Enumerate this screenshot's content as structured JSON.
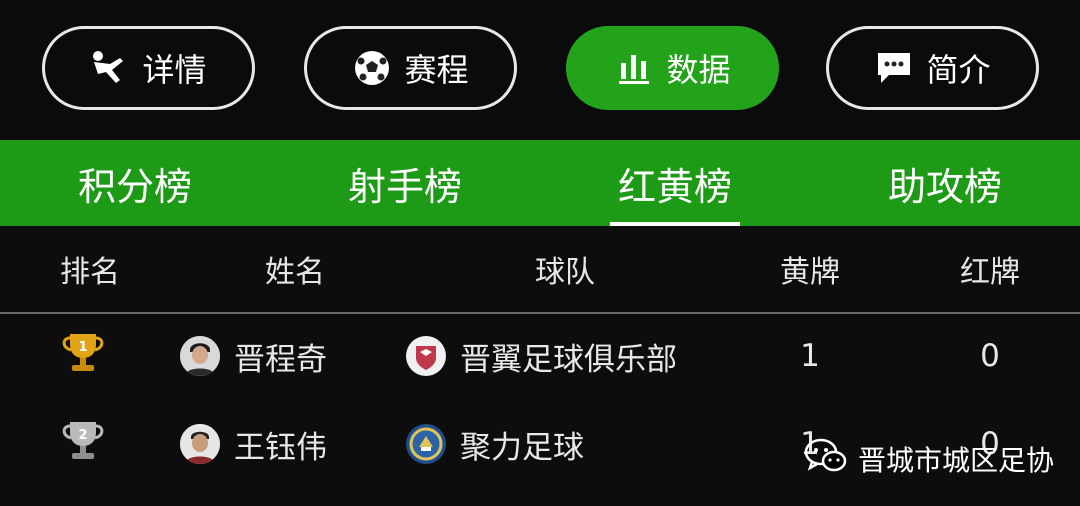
{
  "top_nav": [
    {
      "label": "详情",
      "icon": "player-kick-icon",
      "active": false
    },
    {
      "label": "赛程",
      "icon": "soccer-ball-icon",
      "active": false
    },
    {
      "label": "数据",
      "icon": "bar-chart-icon",
      "active": true
    },
    {
      "label": "简介",
      "icon": "chat-bubble-icon",
      "active": false
    }
  ],
  "tabs": [
    {
      "label": "积分榜",
      "active": false
    },
    {
      "label": "射手榜",
      "active": false
    },
    {
      "label": "红黄榜",
      "active": true
    },
    {
      "label": "助攻榜",
      "active": false
    }
  ],
  "table": {
    "headers": {
      "rank": "排名",
      "name": "姓名",
      "team": "球队",
      "yellow": "黄牌",
      "red": "红牌"
    },
    "rows": [
      {
        "rank_icon": "gold-trophy-icon",
        "rank": "1",
        "name": "晋程奇",
        "team": "晋翼足球俱乐部",
        "yellow": "1",
        "red": "0"
      },
      {
        "rank_icon": "silver-trophy-icon",
        "rank": "2",
        "name": "王钰伟",
        "team": "聚力足球",
        "yellow": "1",
        "red": "0"
      }
    ]
  },
  "watermark": {
    "text": "晋城市城区足协",
    "icon": "wechat-icon"
  },
  "colors": {
    "accent": "#22a31a",
    "tab_bar": "#1e9b16",
    "background": "#000000"
  }
}
